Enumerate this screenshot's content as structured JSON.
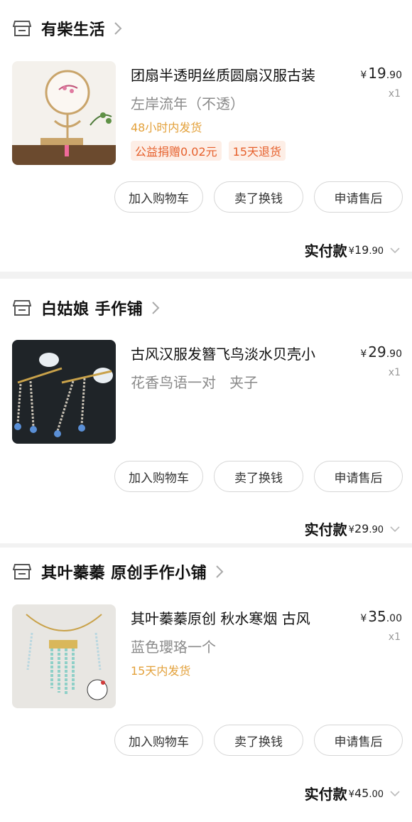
{
  "orders": [
    {
      "shop": "有柴生活",
      "title": "团扇半透明丝质圆扇汉服古装",
      "spec": "左岸流年（不透）",
      "ship": "48小时内发货",
      "tags": [
        "公益捐赠0.02元",
        "15天退货"
      ],
      "price_int": "19",
      "price_dec": ".90",
      "qty": "x1",
      "paid_int": "19",
      "paid_dec": ".90"
    },
    {
      "shop": "白姑娘 手作铺",
      "title": "古风汉服发簪飞鸟淡水贝壳小",
      "spec": "花香鸟语一对   夹子",
      "price_int": "29",
      "price_dec": ".90",
      "qty": "x1",
      "paid_int": "29",
      "paid_dec": ".90"
    },
    {
      "shop": "其叶蓁蓁 原创手作小铺",
      "title": "其叶蓁蓁原创 秋水寒烟 古风",
      "spec": "蓝色瓔珞一个",
      "ship": "15天内发货",
      "price_int": "35",
      "price_dec": ".00",
      "qty": "x1",
      "paid_int": "45",
      "paid_dec": ".00"
    }
  ],
  "buttons": {
    "add_cart": "加入购物车",
    "resell": "卖了换钱",
    "after_sale": "申请售后"
  },
  "paid_label": "实付款",
  "currency": "¥",
  "icons": {
    "shop": "store-icon",
    "chevron_right": "chevron-right-icon",
    "chevron_down": "chevron-down-icon"
  }
}
